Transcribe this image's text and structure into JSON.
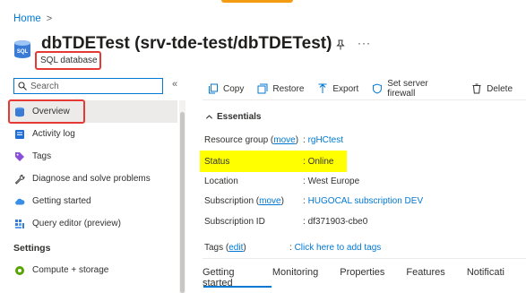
{
  "breadcrumb": {
    "home": "Home",
    "sep": ">"
  },
  "header": {
    "title": "dbTDETest (srv-tde-test/dbTDETest)",
    "subtitle": "SQL database",
    "icon": "sql-database-icon",
    "more": "···"
  },
  "search": {
    "placeholder": "Search"
  },
  "sidebar": {
    "collapse": "«",
    "items": [
      {
        "label": "Overview",
        "icon": "sql-icon"
      },
      {
        "label": "Activity log",
        "icon": "activity-log-icon"
      },
      {
        "label": "Tags",
        "icon": "tag-icon"
      },
      {
        "label": "Diagnose and solve problems",
        "icon": "wrench-icon"
      },
      {
        "label": "Getting started",
        "icon": "cloud-icon"
      },
      {
        "label": "Query editor (preview)",
        "icon": "query-grid-icon"
      }
    ],
    "section": "Settings",
    "settings_items": [
      {
        "label": "Compute + storage",
        "icon": "compute-icon"
      }
    ]
  },
  "toolbar": {
    "copy": "Copy",
    "restore": "Restore",
    "export": "Export",
    "firewall": "Set server firewall",
    "delete": "Delete"
  },
  "essentials": {
    "label": "Essentials",
    "resource_group_label": "Resource group",
    "move": "move",
    "resource_group_value": "rgHCtest",
    "status_label": "Status",
    "status_value": "Online",
    "location_label": "Location",
    "location_value": "West Europe",
    "subscription_label": "Subscription",
    "subscription_value": "HUGOCAL subscription DEV",
    "subscription_id_label": "Subscription ID",
    "subscription_id_value": "df371903-cbe0",
    "tags_label": "Tags",
    "edit": "edit",
    "tags_value": "Click here to add tags",
    "colon": ":"
  },
  "tabs": [
    "Getting started",
    "Monitoring",
    "Properties",
    "Features",
    "Notificati"
  ],
  "colors": {
    "accent": "#0078d4",
    "highlight": "#ffff00",
    "annotation": "#e53935"
  }
}
